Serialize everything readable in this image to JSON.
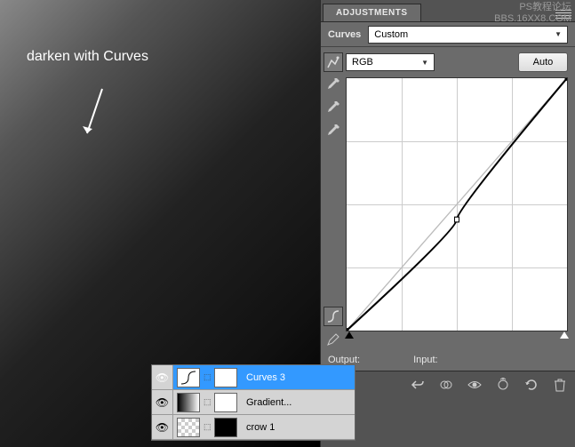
{
  "watermark": {
    "line1": "PS教程论坛",
    "line2": "BBS.16XX8.COM"
  },
  "annotation": {
    "text": "darken with Curves"
  },
  "panel": {
    "tab_label": "ADJUSTMENTS",
    "title": "Curves",
    "preset": "Custom",
    "channel": "RGB",
    "auto_label": "Auto",
    "output_label": "Output:",
    "output_value": "",
    "input_label": "Input:",
    "input_value": ""
  },
  "layers": [
    {
      "name": "Curves 3",
      "selected": true,
      "visible": true,
      "type": "curves",
      "mask": "white"
    },
    {
      "name": "Gradient...",
      "selected": false,
      "visible": true,
      "type": "gradient",
      "mask": "white"
    },
    {
      "name": "crow 1",
      "selected": false,
      "visible": true,
      "type": "image",
      "mask": "black"
    }
  ],
  "chart_data": {
    "type": "line",
    "title": "Curves",
    "xlabel": "Input",
    "ylabel": "Output",
    "xlim": [
      0,
      255
    ],
    "ylim": [
      0,
      255
    ],
    "series": [
      {
        "name": "RGB",
        "x": [
          0,
          128,
          255
        ],
        "y": [
          0,
          112,
          255
        ]
      }
    ]
  }
}
